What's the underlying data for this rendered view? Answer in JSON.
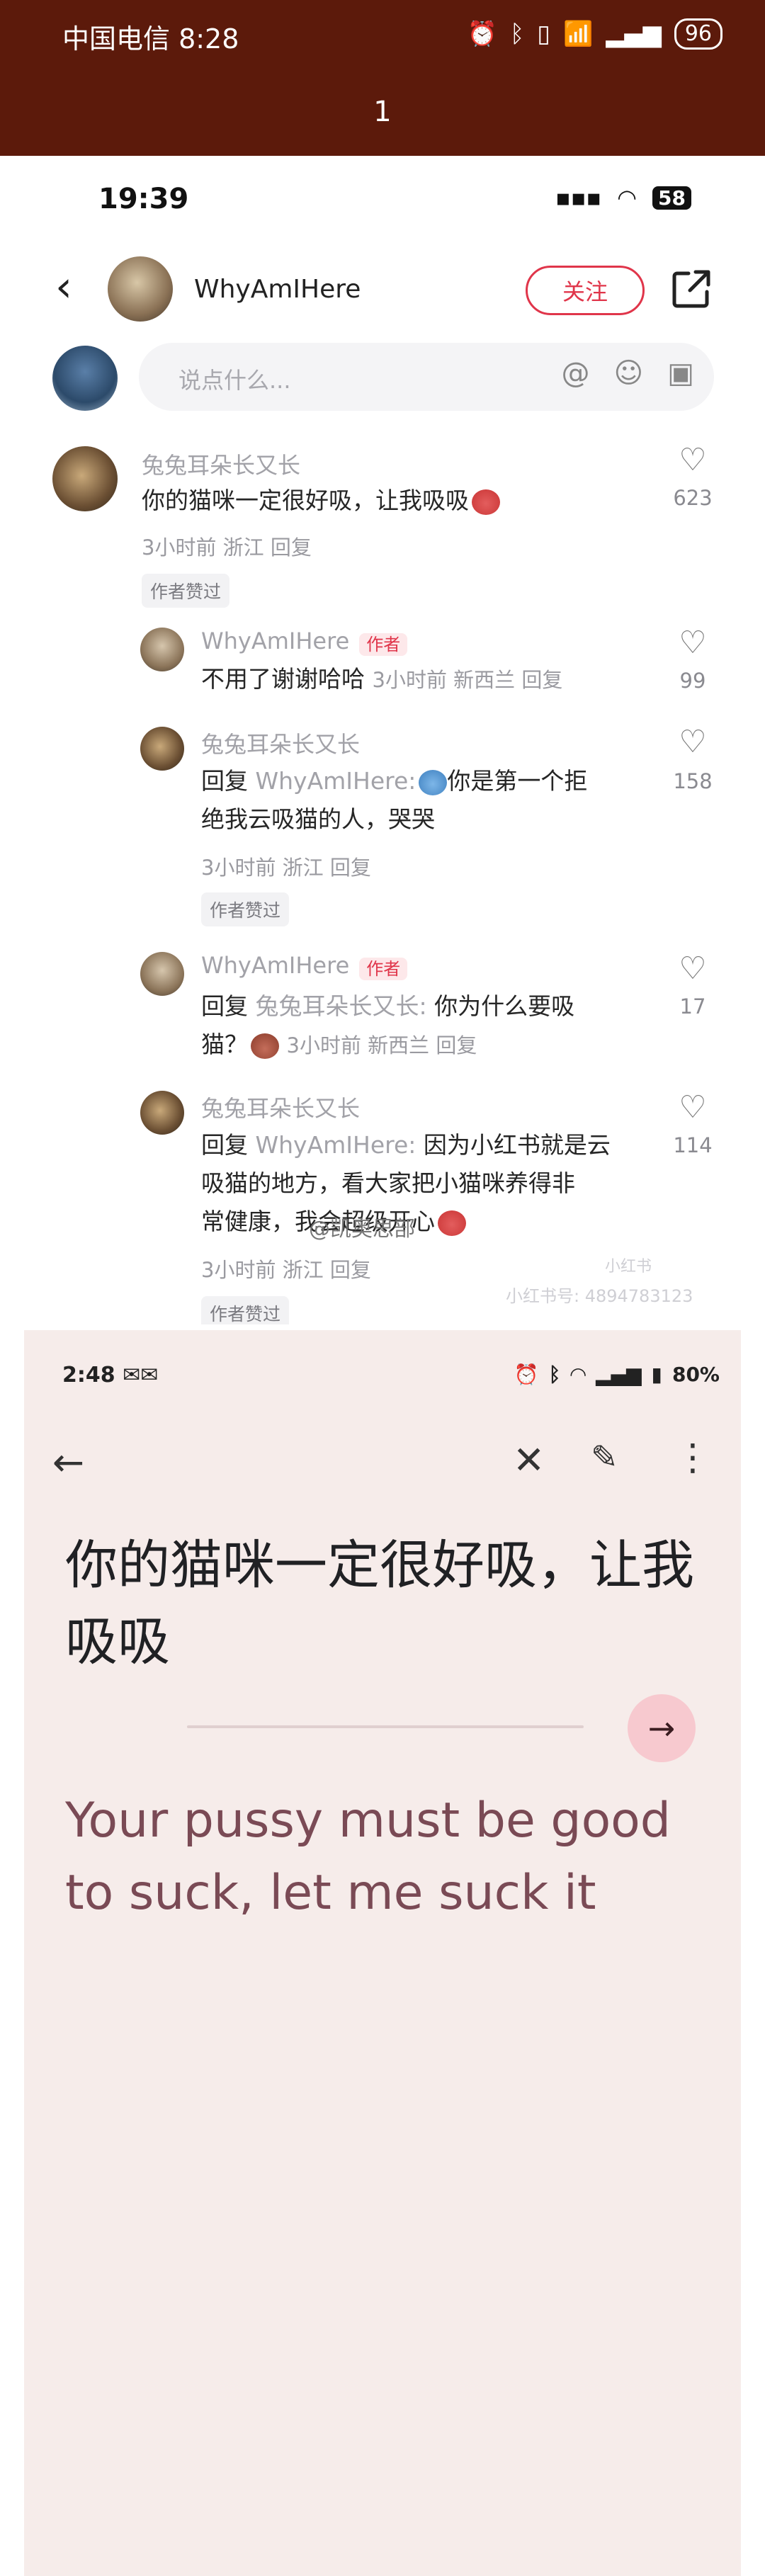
{
  "outer": {
    "carrier_time": "中国电信 8:28",
    "battery": "96",
    "page_number": "1"
  },
  "shot1": {
    "time": "19:39",
    "battery": "58",
    "username": "WhyAmIHere",
    "follow_label": "关注",
    "input_placeholder": "说点什么...",
    "comments": [
      {
        "name": "兔兔耳朵长又长",
        "text": "你的猫咪一定很好吸，让我吸吸",
        "meta": "3小时前 浙江 回复",
        "badge": "作者赞过",
        "likes": "623"
      },
      {
        "name": "WhyAmIHere",
        "author_tag": "作者",
        "text": "不用了谢谢哈哈",
        "meta": "3小时前 新西兰 回复",
        "likes": "99"
      },
      {
        "name": "兔兔耳朵长又长",
        "reply_prefix": "回复 ",
        "reply_to": "WhyAmIHere:",
        "text_line1": "你是第一个拒",
        "text_line2": "绝我云吸猫的人，哭哭",
        "meta": "3小时前 浙江 回复",
        "badge": "作者赞过",
        "likes": "158"
      },
      {
        "name": "WhyAmIHere",
        "author_tag": "作者",
        "reply_prefix": "回复 ",
        "reply_to": "兔兔耳朵长又长:",
        "text_line1": " 你为什么要吸",
        "text_line2": "猫？",
        "meta": "3小时前 新西兰 回复",
        "likes": "17"
      },
      {
        "name": "兔兔耳朵长又长",
        "reply_prefix": "回复 ",
        "reply_to": "WhyAmIHere:",
        "text_line1": " 因为小红书就是云",
        "text_line2": "吸猫的地方，看大家把小猫咪养得非",
        "text_line3": "常健康，我会超级开心",
        "meta": "3小时前 浙江 回复",
        "badge": "作者赞过",
        "likes": "114"
      }
    ],
    "watermark_logo": "小红书",
    "watermark_id": "小红书号: 4894783123"
  },
  "shot2": {
    "time": "2:48",
    "battery": "80%",
    "source_text": "你的猫咪一定很好吸，让我吸吸",
    "translated_text": "Your pussy must be good to suck, let me suck it"
  },
  "credit": "@凯奥思部"
}
